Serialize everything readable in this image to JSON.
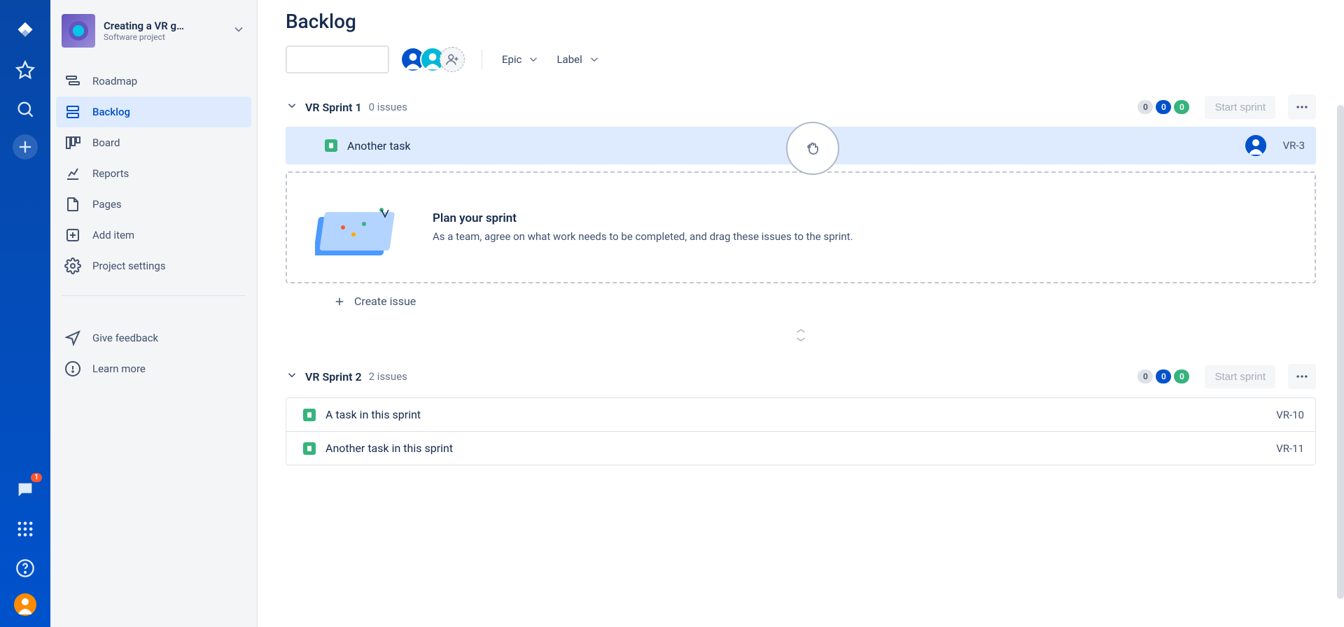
{
  "rail": {
    "notification_count": "1"
  },
  "project": {
    "name": "Creating a VR g…",
    "subtitle": "Software project"
  },
  "sidebar": {
    "items": [
      {
        "label": "Roadmap"
      },
      {
        "label": "Backlog"
      },
      {
        "label": "Board"
      },
      {
        "label": "Reports"
      },
      {
        "label": "Pages"
      },
      {
        "label": "Add item"
      },
      {
        "label": "Project settings"
      }
    ],
    "footer": [
      {
        "label": "Give feedback"
      },
      {
        "label": "Learn more"
      }
    ]
  },
  "page": {
    "title": "Backlog"
  },
  "filters": {
    "epic": "Epic",
    "label": "Label"
  },
  "sprints": [
    {
      "name": "VR Sprint 1",
      "count_text": "0 issues",
      "pills": [
        "0",
        "0",
        "0"
      ],
      "start_label": "Start sprint",
      "dragging_issue": {
        "title": "Another task",
        "key": "VR-3"
      },
      "dropzone": {
        "heading": "Plan your sprint",
        "body": "As a team, agree on what work needs to be completed, and drag these issues to the sprint."
      },
      "create_label": "Create issue"
    },
    {
      "name": "VR Sprint 2",
      "count_text": "2 issues",
      "pills": [
        "0",
        "0",
        "0"
      ],
      "start_label": "Start sprint",
      "issues": [
        {
          "title": "A task in this sprint",
          "key": "VR-10"
        },
        {
          "title": "Another task in this sprint",
          "key": "VR-11"
        }
      ]
    }
  ]
}
